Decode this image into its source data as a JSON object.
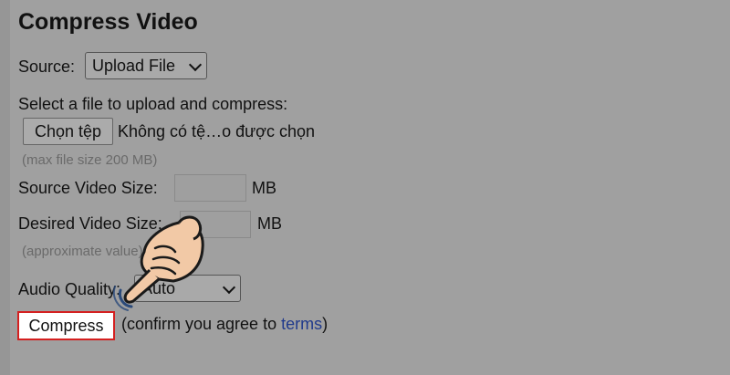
{
  "title": "Compress Video",
  "source": {
    "label": "Source:",
    "selected": "Upload File"
  },
  "upload": {
    "prompt": "Select a file to upload and compress:",
    "choose_button": "Chọn tệp",
    "no_file_text": "Không có tệ…o được chọn",
    "max_size_note": "(max file size 200 MB)"
  },
  "source_size": {
    "label": "Source Video Size:",
    "unit": "MB",
    "value": ""
  },
  "desired_size": {
    "label": "Desired Video Size:",
    "unit": "MB",
    "value": "",
    "note": "(approximate value)"
  },
  "audio": {
    "label": "Audio Quality:",
    "selected": "Auto"
  },
  "actions": {
    "compress_label": "Compress",
    "confirm_prefix": "(confirm you agree to ",
    "terms_link": "terms",
    "confirm_suffix": ")"
  },
  "colors": {
    "page_overlay": "#a0a0a0",
    "highlight": "#d42020",
    "link": "#203a8c",
    "hand_skin": "#f2c9a6"
  },
  "icons": {
    "cursor": "pointing-hand-icon"
  }
}
